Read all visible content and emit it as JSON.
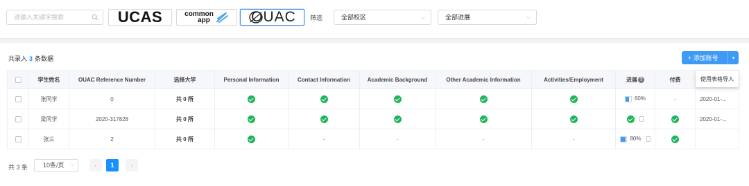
{
  "filters": {
    "search_placeholder": "请输入关键字搜索",
    "logos": {
      "ucas": "UCAS",
      "common_line1": "common",
      "common_line2": "app",
      "ouac": "OUAC"
    },
    "filter_label": "筛选",
    "campus_select": "全部校区",
    "progress_select": "全部进展"
  },
  "summary": {
    "prefix": "共录入",
    "count": "3",
    "suffix": "条数据"
  },
  "toolbar": {
    "add_label": "添加账号",
    "menu_item": "使用表格导入"
  },
  "table": {
    "headers": [
      "学生姓名",
      "OUAC Reference Number",
      "选择大学",
      "Personal Information",
      "Contact Information",
      "Academic Background",
      "Other Academic Information",
      "Activities/Employment",
      "进展",
      "付费"
    ],
    "rows": [
      {
        "name": "张同学",
        "ref": "0",
        "uni": "共 0 所",
        "personal": "check",
        "contact": "check",
        "academic": "check",
        "other": "check",
        "activities": "check",
        "progress_pct": 60,
        "progress_label": "60%",
        "paid": "-",
        "date": "2020-01-..."
      },
      {
        "name": "梁同学",
        "ref": "2020-317828",
        "uni": "共 0 所",
        "personal": "check",
        "contact": "check",
        "academic": "check",
        "other": "check",
        "activities": "check",
        "progress_pct": 100,
        "progress_label": "",
        "paid": "check",
        "date": "2020-01-..."
      },
      {
        "name": "张三",
        "ref": "2",
        "uni": "共 0 所",
        "personal": "check",
        "contact": "-",
        "academic": "-",
        "other": "-",
        "activities": "-",
        "progress_pct": 80,
        "progress_label": "80%",
        "paid": "check",
        "date": ""
      }
    ]
  },
  "pagination": {
    "total": "共 3 条",
    "page_size": "10条/页",
    "current_page": "1",
    "prev": "‹",
    "next": "›"
  },
  "colors": {
    "accent": "#1890ff",
    "check": "#21b45b"
  }
}
